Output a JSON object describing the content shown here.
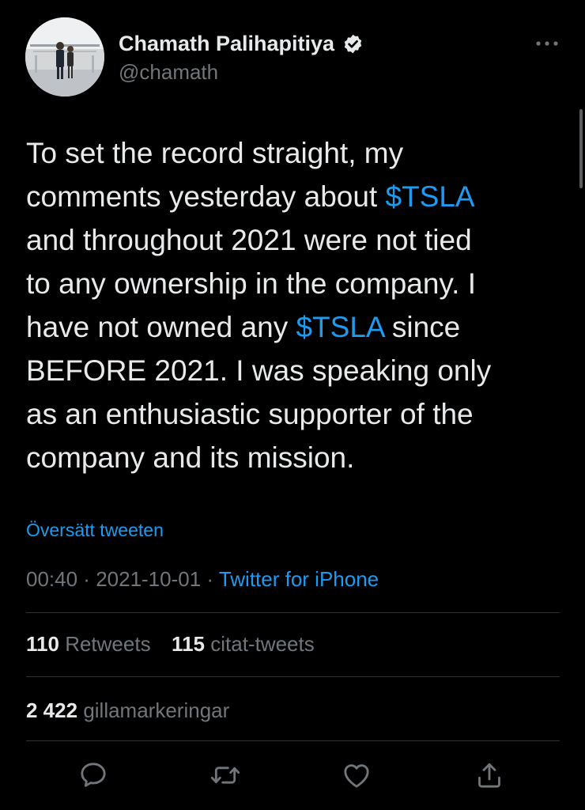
{
  "author": {
    "display_name": "Chamath Palihapitiya",
    "handle": "@chamath",
    "verified": true
  },
  "tweet": {
    "lines": [
      [
        {
          "text": "To set the record straight, my",
          "cashtag": false
        }
      ],
      [
        {
          "text": "comments yesterday about ",
          "cashtag": false
        },
        {
          "text": "$TSLA",
          "cashtag": true
        }
      ],
      [
        {
          "text": "and throughout 2021 were not tied",
          "cashtag": false
        }
      ],
      [
        {
          "text": "to any ownership in the company. I",
          "cashtag": false
        }
      ],
      [
        {
          "text": "have not owned any ",
          "cashtag": false
        },
        {
          "text": "$TSLA",
          "cashtag": true
        },
        {
          "text": " since",
          "cashtag": false
        }
      ],
      [
        {
          "text": "BEFORE 2021. I was speaking only",
          "cashtag": false
        }
      ],
      [
        {
          "text": "as an enthusiastic supporter of the",
          "cashtag": false
        }
      ],
      [
        {
          "text": "company and its mission.",
          "cashtag": false
        }
      ]
    ],
    "translate_label": "Översätt tweeten",
    "time": "00:40",
    "date": "2021-10-01",
    "separator": " · ",
    "source": "Twitter for iPhone"
  },
  "stats": {
    "retweets_count": "110",
    "retweets_label": "Retweets",
    "quotes_count": "115",
    "quotes_label": "citat-tweets",
    "likes_count": "2 422",
    "likes_label": "gillamarkeringar"
  },
  "actions": [
    {
      "name": "reply-icon"
    },
    {
      "name": "retweet-icon"
    },
    {
      "name": "like-icon"
    },
    {
      "name": "share-icon"
    }
  ],
  "colors": {
    "background": "#000000",
    "text": "#e7e9ea",
    "secondary": "#71767b",
    "accent": "#1d9bf0",
    "divider": "#2f3336"
  }
}
